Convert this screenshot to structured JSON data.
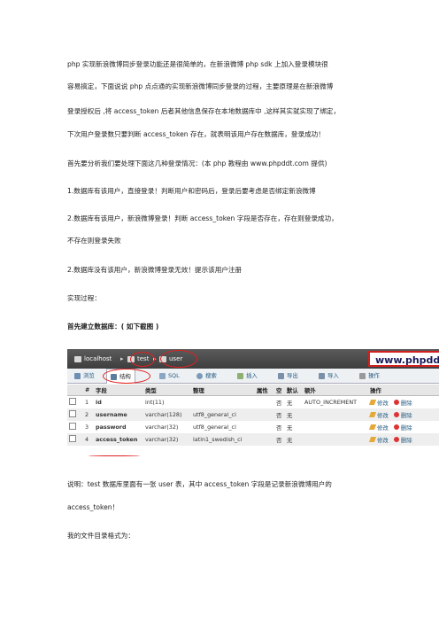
{
  "paragraphs": [
    "php 实现新浪微博同步登录功能还是很简单的，在新浪微博 php    sdk 上加入登录模块很",
    "容易搞定，下面说说 php 点点通的实现新浪微博同步登录的过程，主要原理是在新浪微博",
    "登录授权后 ,将 access_token 后者其他信息保存在本地数据库中 ,这样其实就实现了绑定，",
    "下次用户登录数只要判断 access_token 存在，就表明该用户存在数据库，登录成功！",
    "首先要分析我们要处理下面这几种登录情况：(本 php 教程由 www.phpddt.com 提供)",
    "1.数据库有该用户，直接登录！判断用户和密码后，登录后要考虑是否绑定新浪微博",
    "2.数据库有该用户，新浪微博登录！判断 access_token 字段是否存在，存在则登录成功，",
    "不存在则登录失败",
    "2.数据库没有该用户，新浪微博登录无效！提示该用户注册",
    "实现过程：",
    "首先建立数据库：( 如下截图 )",
    "说明：test  数据库里面有一张  user  表，其中  access_token  字段是记录新浪微博用户的",
    "access_token！",
    "我的文件目录格式为："
  ],
  "screenshot": {
    "breadcrumb": {
      "server": "localhost",
      "database": "test",
      "table": "user",
      "separator": "▸"
    },
    "watermark": "www.phpddt.com",
    "tabs": [
      "浏览",
      "结构",
      "SQL",
      "搜索",
      "插入",
      "导出",
      "导入",
      "操作"
    ],
    "active_tab": "结构",
    "headers": [
      "#",
      "字段",
      "类型",
      "整理",
      "属性",
      "空",
      "默认",
      "额外",
      "操作"
    ],
    "rows": [
      {
        "num": "1",
        "field": "id",
        "type": "int(11)",
        "collation": "",
        "attr": "",
        "null": "否",
        "default": "无",
        "extra": "AUTO_INCREMENT",
        "edit": "修改",
        "delete": "删除"
      },
      {
        "num": "2",
        "field": "username",
        "type": "varchar(128)",
        "collation": "utf8_general_ci",
        "attr": "",
        "null": "否",
        "default": "无",
        "extra": "",
        "edit": "修改",
        "delete": "删除"
      },
      {
        "num": "3",
        "field": "password",
        "type": "varchar(32)",
        "collation": "utf8_general_ci",
        "attr": "",
        "null": "否",
        "default": "无",
        "extra": "",
        "edit": "修改",
        "delete": "删除"
      },
      {
        "num": "4",
        "field": "access_token",
        "type": "varchar(32)",
        "collation": "latin1_swedish_ci",
        "attr": "",
        "null": "否",
        "default": "无",
        "extra": "",
        "edit": "修改",
        "delete": "删除"
      }
    ]
  },
  "colors": {
    "highlight": "#e02020",
    "link": "#235a81",
    "breadcrumb_bg": "#4a4a4a"
  }
}
